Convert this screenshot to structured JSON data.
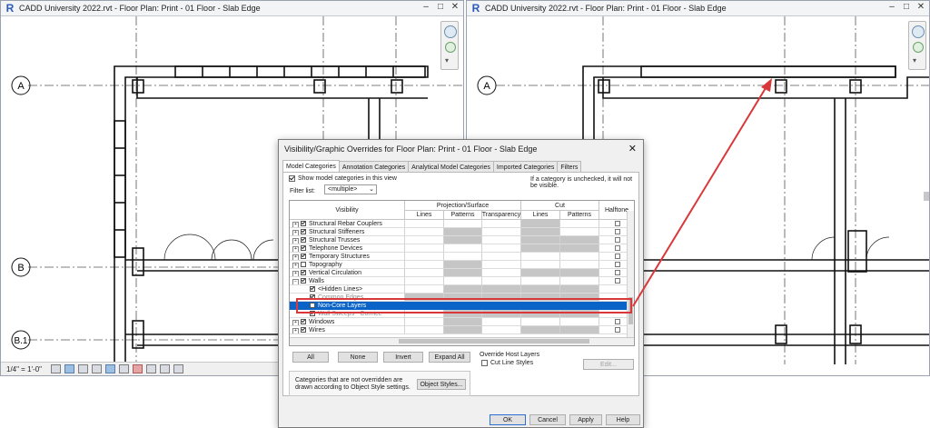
{
  "left_window": {
    "title": "CADD University 2022.rvt - Floor Plan: Print - 01 Floor - Slab Edge",
    "grid_labels": [
      "A",
      "B",
      "B.1"
    ],
    "scale": "1/4\" = 1'-0\""
  },
  "right_window": {
    "title": "CADD University 2022.rvt - Floor Plan: Print - 01 Floor - Slab Edge",
    "grid_labels": [
      "A"
    ]
  },
  "window_controls": {
    "minimize": "–",
    "maximize": "□",
    "close": "✕"
  },
  "dialog": {
    "title": "Visibility/Graphic Overrides for Floor Plan: Print - 01 Floor - Slab Edge",
    "close": "✕",
    "tabs": [
      "Model Categories",
      "Annotation Categories",
      "Analytical Model Categories",
      "Imported Categories",
      "Filters"
    ],
    "show_model_label": "Show model categories in this view",
    "info_text": "If a category is unchecked, it will not be visible.",
    "filter_label": "Filter list:",
    "filter_value": "<multiple>",
    "columns": {
      "visibility": "Visibility",
      "projection_surface": "Projection/Surface",
      "cut": "Cut",
      "halftone": "Halftone",
      "lines": "Lines",
      "patterns": "Patterns",
      "transparency": "Transparency",
      "cut_lines": "Lines",
      "cut_patterns": "Patterns"
    },
    "rows": [
      {
        "label": "Structural Rebar Couplers",
        "expander": "+",
        "checked": true,
        "indent": 0
      },
      {
        "label": "Structural Stiffeners",
        "expander": "+",
        "checked": true,
        "indent": 0
      },
      {
        "label": "Structural Trusses",
        "expander": "+",
        "checked": true,
        "indent": 0
      },
      {
        "label": "Telephone Devices",
        "expander": "+",
        "checked": true,
        "indent": 0
      },
      {
        "label": "Temporary Structures",
        "expander": "+",
        "checked": true,
        "indent": 0
      },
      {
        "label": "Topography",
        "expander": "+",
        "checked": false,
        "indent": 0
      },
      {
        "label": "Vertical Circulation",
        "expander": "+",
        "checked": true,
        "indent": 0
      },
      {
        "label": "Walls",
        "expander": "−",
        "checked": true,
        "indent": 0
      },
      {
        "label": "<Hidden Lines>",
        "expander": "",
        "checked": true,
        "indent": 1
      },
      {
        "label": "Common Edges",
        "expander": "",
        "checked": true,
        "indent": 1
      },
      {
        "label": "Non-Core Layers",
        "expander": "",
        "checked": false,
        "indent": 1,
        "selected": true
      },
      {
        "label": "Wall Sweeps - Cornice",
        "expander": "",
        "checked": true,
        "indent": 1
      },
      {
        "label": "Windows",
        "expander": "+",
        "checked": true,
        "indent": 0
      },
      {
        "label": "Wires",
        "expander": "+",
        "checked": true,
        "indent": 0
      }
    ],
    "buttons": {
      "all": "All",
      "none": "None",
      "invert": "Invert",
      "expand_all": "Expand All"
    },
    "override_host_title": "Override Host Layers",
    "cut_line_styles": "Cut Line Styles",
    "edit_button": "Edit...",
    "note": "Categories that are not overridden are drawn according to Object Style settings.",
    "object_styles": "Object Styles...",
    "footer": {
      "ok": "OK",
      "cancel": "Cancel",
      "apply": "Apply",
      "help": "Help"
    }
  },
  "colors": {
    "highlight": "#d9383a",
    "selection": "#0a64c8"
  }
}
